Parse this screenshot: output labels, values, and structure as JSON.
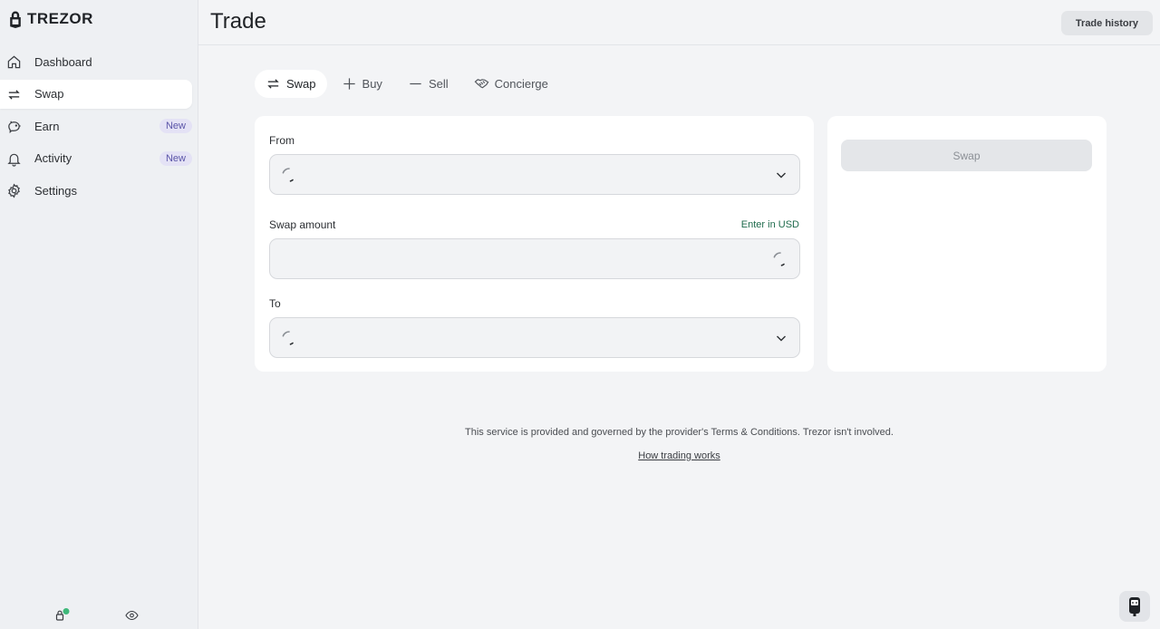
{
  "brand": {
    "name": "TREZOR"
  },
  "sidebar": {
    "items": [
      {
        "label": "Dashboard",
        "icon": "home-icon",
        "active": false
      },
      {
        "label": "Swap",
        "icon": "swap-icon",
        "active": true
      },
      {
        "label": "Earn",
        "icon": "piggy-bank-icon",
        "active": false,
        "badge": "New"
      },
      {
        "label": "Activity",
        "icon": "bell-icon",
        "active": false,
        "badge": "New"
      },
      {
        "label": "Settings",
        "icon": "gear-icon",
        "active": false
      }
    ],
    "footer": {
      "lock_icon": "lock-icon",
      "eye_icon": "eye-icon"
    }
  },
  "header": {
    "title": "Trade",
    "history_label": "Trade history"
  },
  "tabs": [
    {
      "label": "Swap",
      "icon": "swap-icon",
      "active": true
    },
    {
      "label": "Buy",
      "icon": "plus-icon",
      "active": false
    },
    {
      "label": "Sell",
      "icon": "minus-icon",
      "active": false
    },
    {
      "label": "Concierge",
      "icon": "handshake-icon",
      "active": false
    }
  ],
  "form": {
    "from_label": "From",
    "amount_label": "Swap amount",
    "enter_usd_label": "Enter in USD",
    "to_label": "To"
  },
  "summary": {
    "swap_button_label": "Swap"
  },
  "footer": {
    "disclaimer": "This service is provided and governed by the provider's Terms & Conditions. Trezor isn't involved.",
    "how_link": "How trading works"
  },
  "colors": {
    "accent_green": "#1e6b4c",
    "badge_bg": "#e4e2f5",
    "badge_text": "#5b55a8"
  }
}
